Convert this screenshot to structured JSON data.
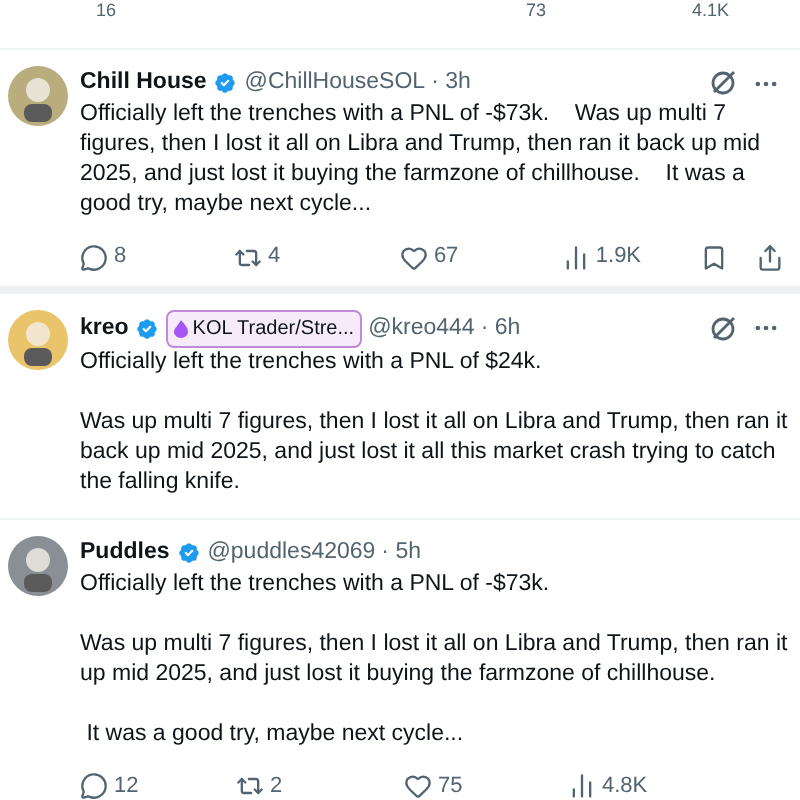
{
  "previous_tweet_actions": {
    "replies": "16",
    "likes": "73",
    "views": "4.1K"
  },
  "tweets": [
    {
      "name": "Chill House",
      "verified": true,
      "handle": "@ChillHouseSOL",
      "time": "· 3h",
      "menu": true,
      "paragraphs": [
        "Officially left the trenches with a PNL of -$73k.    Was up multi 7 figures, then I lost it all on Libra and Trump, then ran it back up mid 2025, and just lost it buying the farmzone of chillhouse.    It was a good try, maybe next cycle..."
      ],
      "actions": {
        "replies": "8",
        "reposts": "4",
        "likes": "67",
        "views": "1.9K"
      }
    },
    {
      "name": "kreo",
      "verified": true,
      "badge": "KOL Trader/Stre...",
      "handle": "@kreo444",
      "time": "· 6h",
      "menu": true,
      "paragraphs": [
        "Officially left the trenches with a PNL of $24k.",
        "Was up multi 7 figures, then I lost it all on Libra and Trump, then ran it back up mid 2025, and just lost it all this market crash trying to catch the falling knife."
      ]
    },
    {
      "name": "Puddles",
      "verified": true,
      "handle": "@puddles42069",
      "time": "· 5h",
      "menu": false,
      "paragraphs": [
        "Officially left the trenches with a PNL of -$73k.",
        "Was up multi 7 figures, then I lost it all on Libra and Trump, then ran it up mid 2025, and just lost it buying the farmzone of chillhouse.",
        " It was a good try, maybe next cycle..."
      ],
      "actions": {
        "replies": "12",
        "reposts": "2",
        "likes": "75",
        "views": "4.8K"
      }
    }
  ]
}
